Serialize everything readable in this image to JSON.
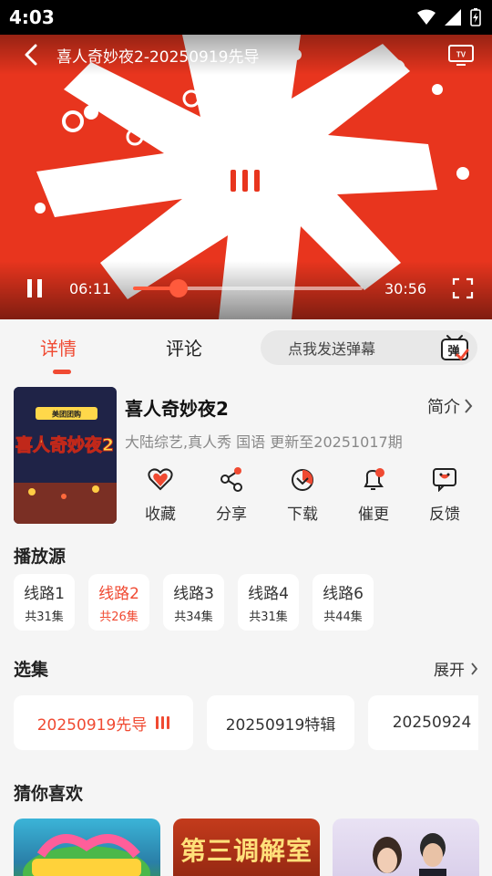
{
  "status_bar": {
    "time": "4:03"
  },
  "player": {
    "title": "喜人奇妙夜2-20250919先导",
    "current_time": "06:11",
    "total_time": "30:56",
    "progress": 0.2
  },
  "tabs": {
    "details": "详情",
    "comments": "评论"
  },
  "danmu": {
    "placeholder": "点我发送弹幕",
    "icon_text": "弹"
  },
  "show": {
    "title": "喜人奇妙夜2",
    "intro": "简介",
    "meta": "大陆综艺,真人秀 国语 更新至20251017期",
    "poster_brand": "美团团购",
    "poster_title": "喜人奇妙夜2"
  },
  "actions": [
    {
      "label": "收藏",
      "icon": "heart-icon"
    },
    {
      "label": "分享",
      "icon": "share-icon"
    },
    {
      "label": "下载",
      "icon": "download-icon"
    },
    {
      "label": "催更",
      "icon": "bell-icon"
    },
    {
      "label": "反馈",
      "icon": "feedback-icon"
    }
  ],
  "sources": {
    "title": "播放源",
    "items": [
      {
        "name": "线路1",
        "count": "共31集"
      },
      {
        "name": "线路2",
        "count": "共26集"
      },
      {
        "name": "线路3",
        "count": "共34集"
      },
      {
        "name": "线路4",
        "count": "共31集"
      },
      {
        "name": "线路6",
        "count": "共44集"
      }
    ]
  },
  "episodes": {
    "title": "选集",
    "expand": "展开",
    "items": [
      "20250919先导",
      "20250919特辑",
      "20250924"
    ]
  },
  "recommend": {
    "title": "猜你喜欢",
    "items": [
      "",
      "第三调解室",
      ""
    ]
  },
  "colors": {
    "accent": "#f04a32",
    "player_bg": "#e8351e"
  }
}
